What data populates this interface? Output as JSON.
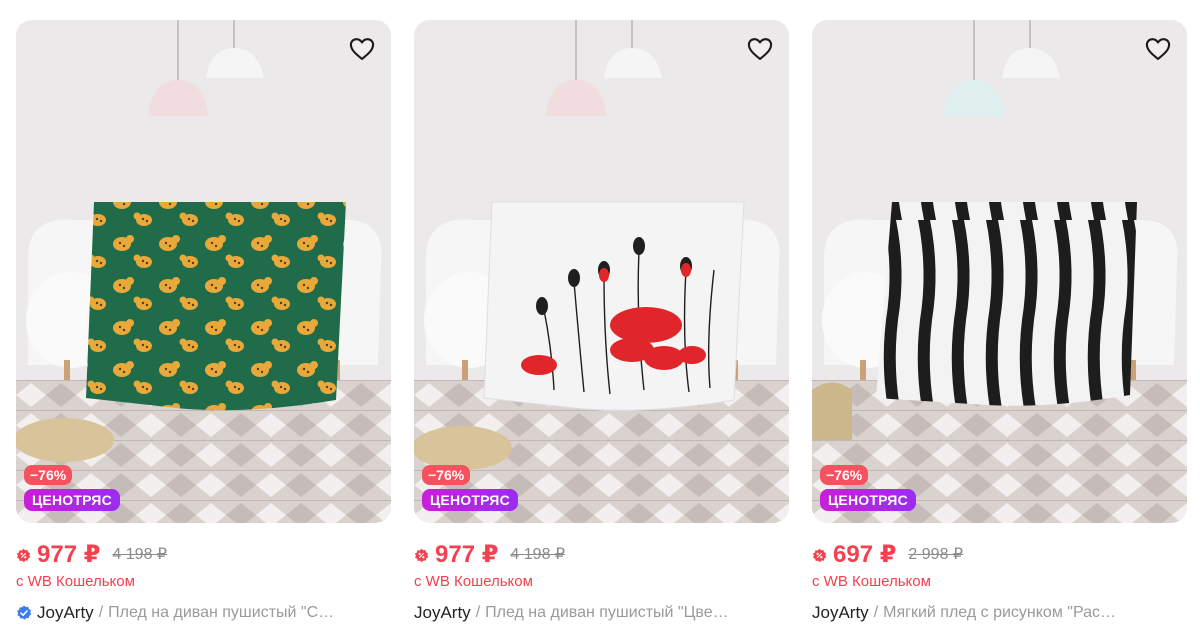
{
  "products": [
    {
      "discount": "−76%",
      "promo": "ЦЕНОТРЯС",
      "price": "977 ₽",
      "old_price": "4 198 ₽",
      "wallet_note": "с WB Кошельком",
      "brand": "JoyArty",
      "verified": true,
      "separator": "/",
      "name": "Плед на диван пушистый \"С…",
      "pattern": "leopard",
      "favorite_icon": "heart-outline-icon"
    },
    {
      "discount": "−76%",
      "promo": "ЦЕНОТРЯС",
      "price": "977 ₽",
      "old_price": "4 198 ₽",
      "wallet_note": "с WB Кошельком",
      "brand": "JoyArty",
      "verified": false,
      "separator": "/",
      "name": "Плед на диван пушистый \"Цве…",
      "pattern": "poppies",
      "favorite_icon": "heart-outline-icon"
    },
    {
      "discount": "−76%",
      "promo": "ЦЕНОТРЯС",
      "price": "697 ₽",
      "old_price": "2 998 ₽",
      "wallet_note": "с WB Кошельком",
      "brand": "JoyArty",
      "verified": false,
      "separator": "/",
      "name": "Мягкий плед с рисунком \"Рас…",
      "pattern": "zebra",
      "favorite_icon": "heart-outline-icon"
    }
  ],
  "colors": {
    "price": "#f5404f",
    "discount_badge": "#f5515f",
    "promo_badge_start": "#c81fd8",
    "promo_badge_end": "#9b2cf0",
    "verified": "#3d7cf0"
  }
}
